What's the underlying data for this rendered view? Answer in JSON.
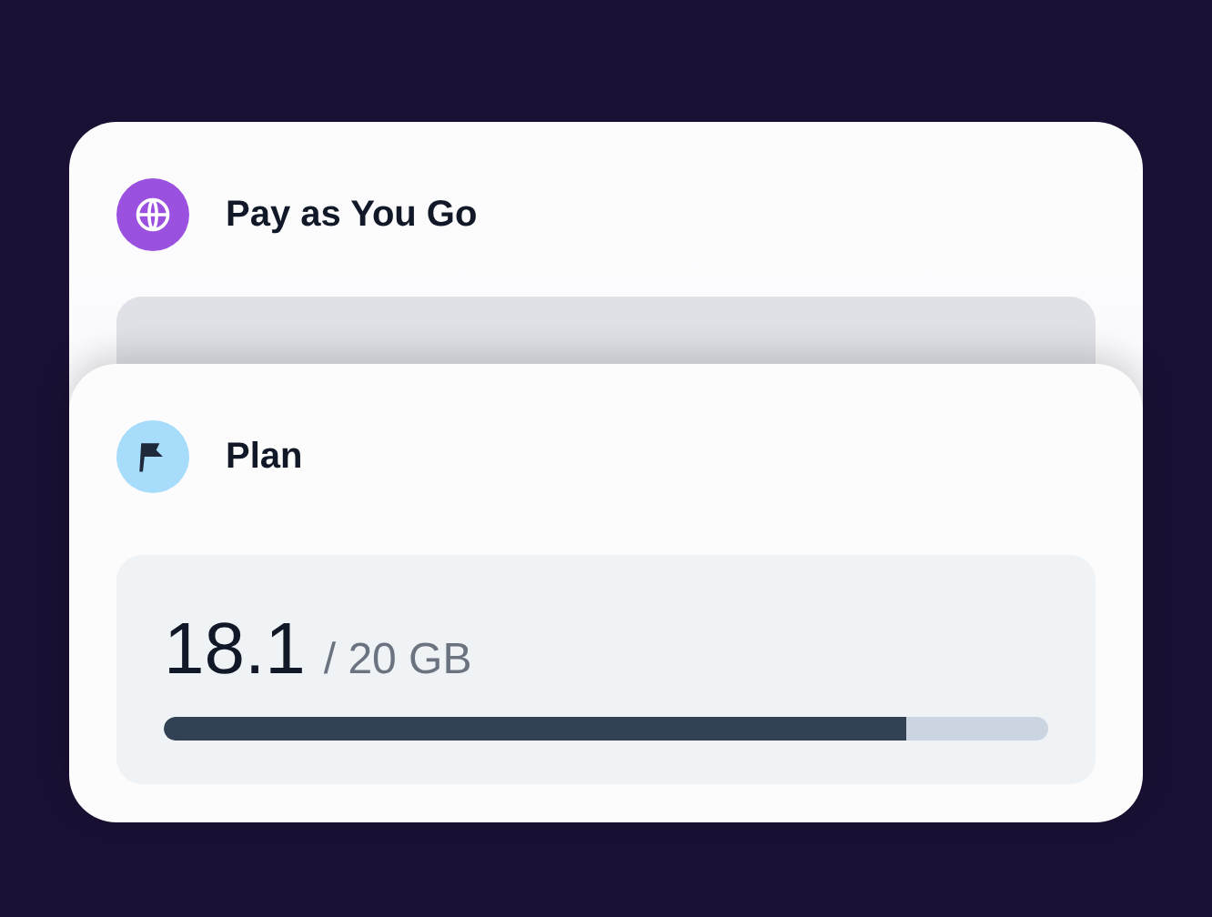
{
  "cards": [
    {
      "kind": "balance",
      "title": "Pay as You Go"
    },
    {
      "kind": "usage",
      "title": "Plan",
      "used": "18.1",
      "total": "/ 20 GB",
      "level": 0.84
    }
  ]
}
